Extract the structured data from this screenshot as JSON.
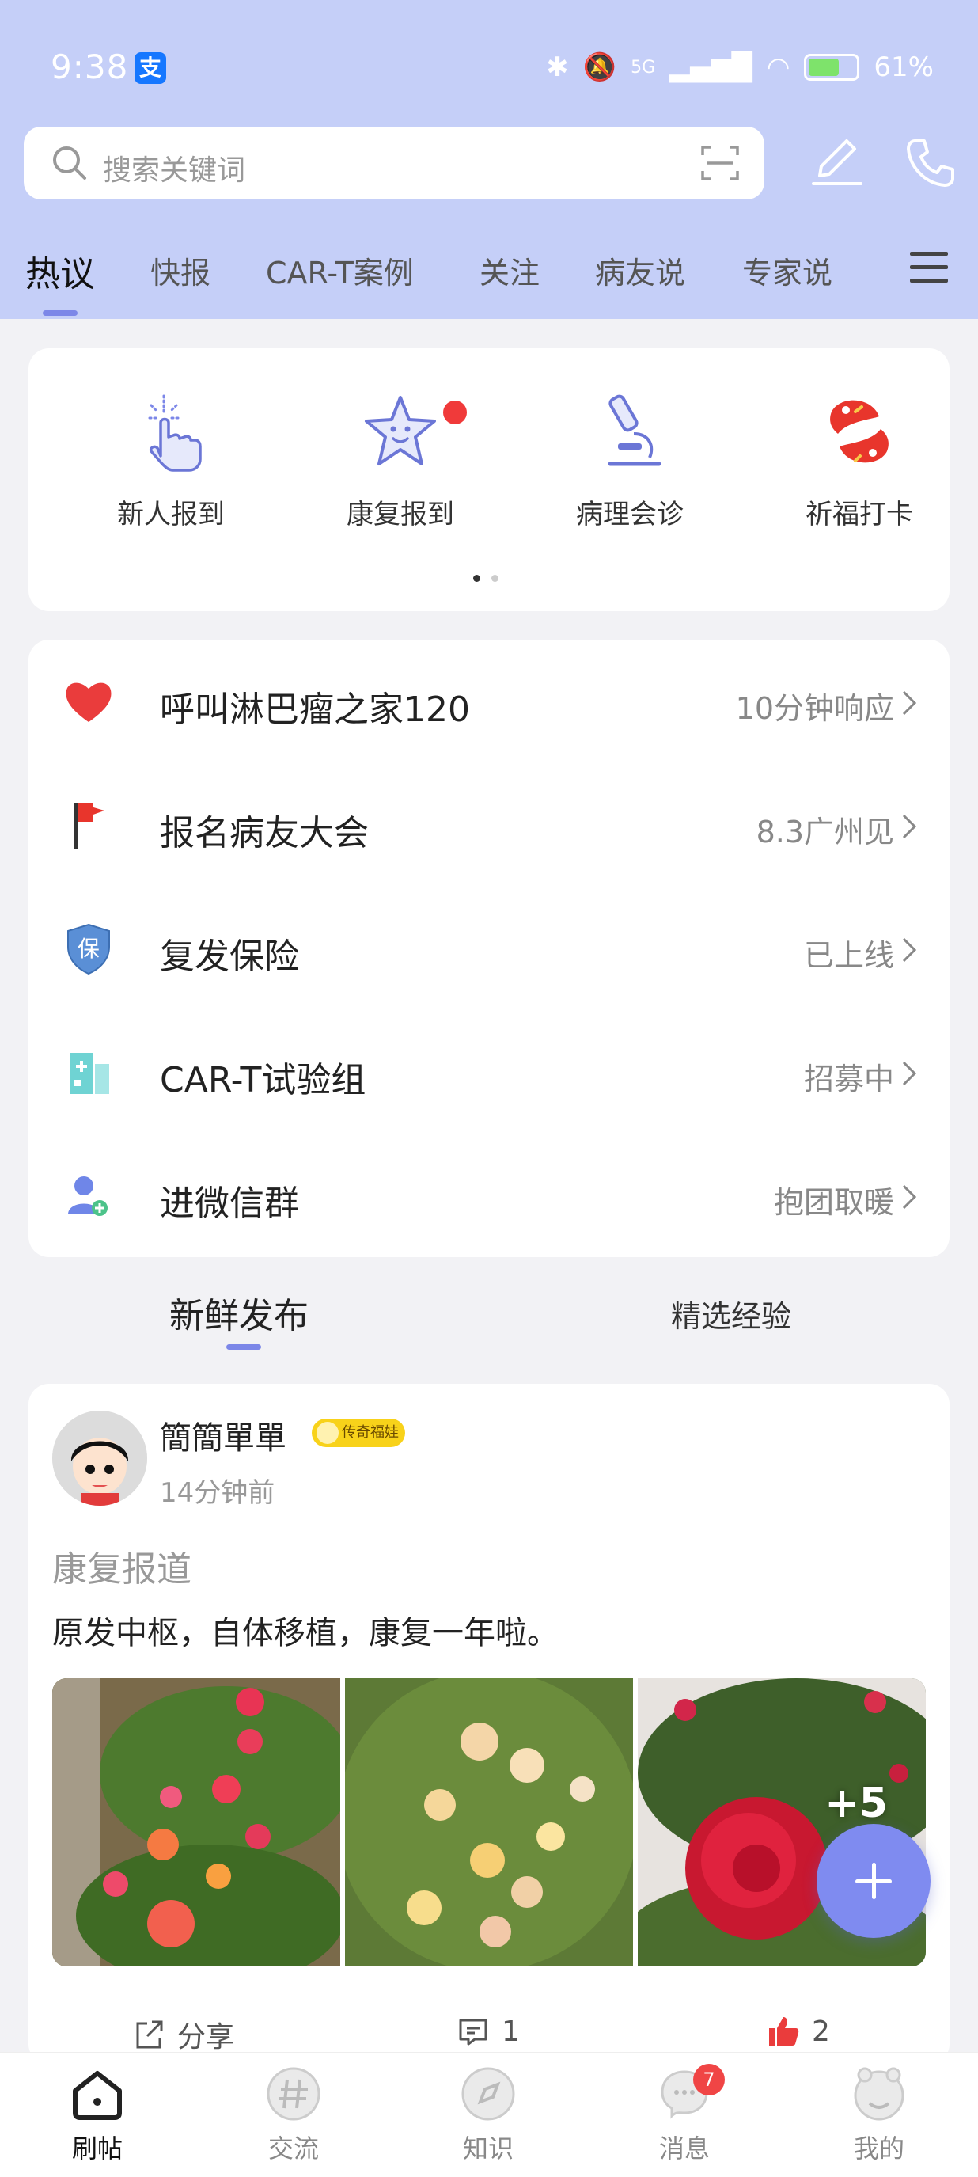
{
  "status_bar": {
    "time": "9:38",
    "battery": "61%",
    "network": "5G"
  },
  "search": {
    "placeholder": "搜索关键词"
  },
  "tabs": [
    {
      "label": "热议",
      "active": true
    },
    {
      "label": "快报"
    },
    {
      "label": "CAR-T案例"
    },
    {
      "label": "关注"
    },
    {
      "label": "病友说"
    },
    {
      "label": "专家说"
    }
  ],
  "quick_actions": [
    {
      "label": "新人报到",
      "icon": "tap-hand-icon"
    },
    {
      "label": "康复报到",
      "icon": "star-face-icon",
      "has_dot": true
    },
    {
      "label": "病理会诊",
      "icon": "microscope-icon"
    },
    {
      "label": "祈福打卡",
      "icon": "koi-fish-icon"
    }
  ],
  "list_items": [
    {
      "title": "呼叫淋巴瘤之家120",
      "meta": "10分钟响应",
      "icon": "heart-icon"
    },
    {
      "title": "报名病友大会",
      "meta": "8.3广州见",
      "icon": "red-flag-icon"
    },
    {
      "title": "复发保险",
      "meta": "已上线",
      "icon": "shield-icon"
    },
    {
      "title": "CAR-T试验组",
      "meta": "招募中",
      "icon": "hospital-icon"
    },
    {
      "title": "进微信群",
      "meta": "抱团取暖",
      "icon": "add-user-icon"
    }
  ],
  "feed_tabs": [
    {
      "label": "新鲜发布",
      "active": true
    },
    {
      "label": "精选经验"
    }
  ],
  "post": {
    "username": "簡簡單單",
    "badge": "传奇福娃",
    "time": "14分钟前",
    "title": "康复报道",
    "text": "原发中枢，自体移植，康复一年啦。",
    "more_images": "+5",
    "share_label": "分享",
    "comment_count": "1",
    "like_count": "2"
  },
  "bottom_nav": [
    {
      "label": "刷帖",
      "icon": "home-icon",
      "active": true
    },
    {
      "label": "交流",
      "icon": "hashtag-icon"
    },
    {
      "label": "知识",
      "icon": "compass-icon"
    },
    {
      "label": "消息",
      "icon": "chat-icon",
      "badge": "7"
    },
    {
      "label": "我的",
      "icon": "profile-icon"
    }
  ],
  "colors": {
    "header_bg": "#c5cff8",
    "accent": "#7c87e8",
    "fab": "#7f8bf0",
    "badge_red": "#f04545"
  }
}
